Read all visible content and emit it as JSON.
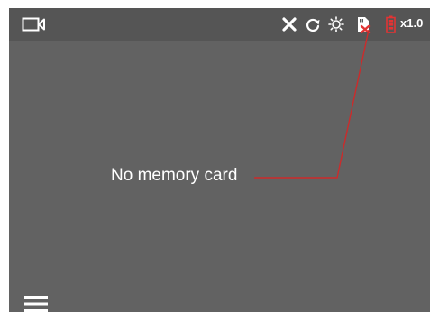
{
  "status_bar": {
    "icons": [
      "video-camera-icon",
      "wifi-off-icon",
      "rotate-icon",
      "brightness-icon",
      "memory-card-missing-icon",
      "battery-icon"
    ],
    "zoom_label": "x1.0"
  },
  "main": {
    "message": "No memory card"
  },
  "menu": {
    "icon": "hamburger-menu-icon"
  },
  "colors": {
    "screen_bg": "#626262",
    "top_bar_bg": "#555555",
    "icon": "#ffffff",
    "callout_line": "#cc2b2b",
    "alert_accent": "#e23434"
  }
}
